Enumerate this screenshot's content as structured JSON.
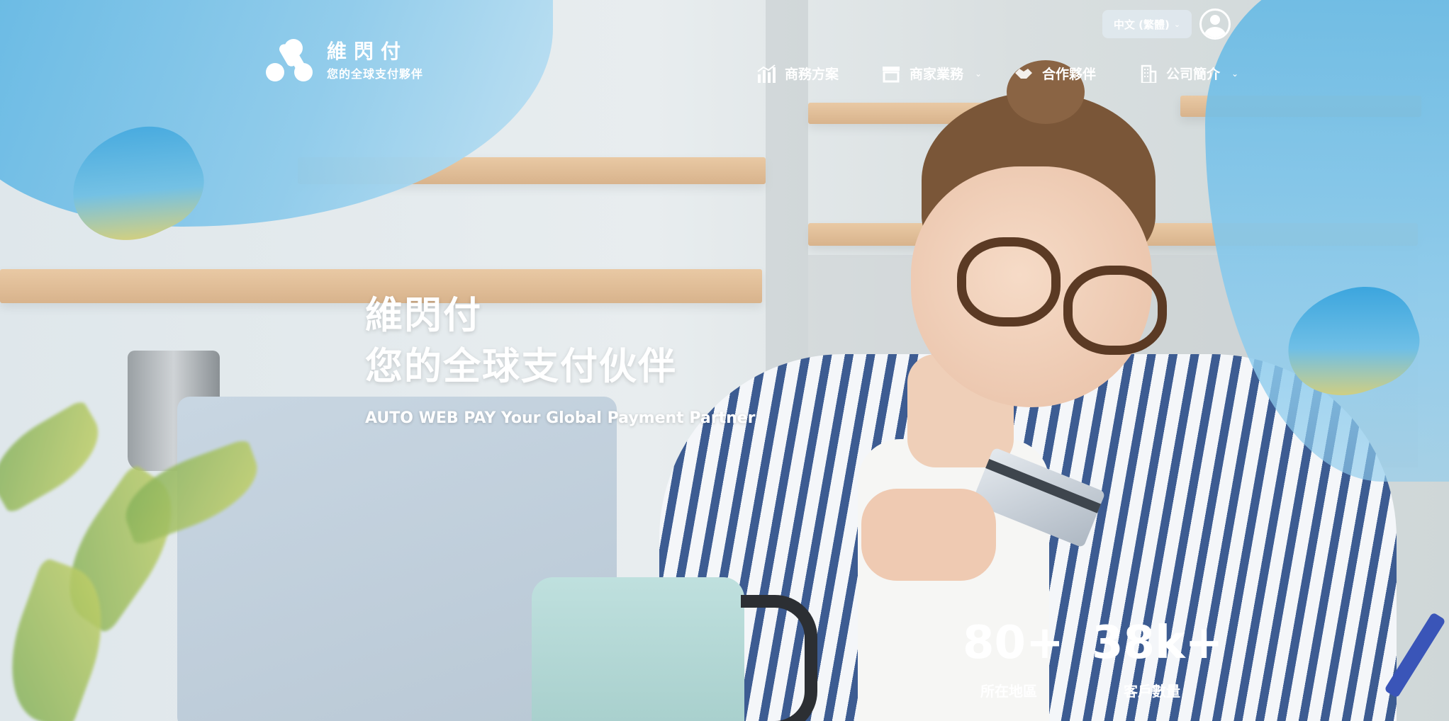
{
  "brand": {
    "name": "維閃付",
    "tagline": "您的全球支付夥伴",
    "accent": "#5fb6e3",
    "highlight": "#f2d45e"
  },
  "header": {
    "language": "中文 (繁體)",
    "language_icon": "chevron-down-icon",
    "account_icon": "user-icon",
    "nav": [
      {
        "label": "商務方案",
        "icon": "bar-chart-icon",
        "has_dropdown": false
      },
      {
        "label": "商家業務",
        "icon": "storefront-icon",
        "has_dropdown": true
      },
      {
        "label": "合作夥伴",
        "icon": "handshake-icon",
        "has_dropdown": false
      },
      {
        "label": "公司簡介",
        "icon": "building-icon",
        "has_dropdown": true
      }
    ]
  },
  "hero": {
    "title_line1": "維閃付",
    "title_line2": "您的全球支付伙伴",
    "subtitle": "AUTO WEB PAY Your Global Payment Partner"
  },
  "stats": [
    {
      "value": "80+",
      "label": "所在地區"
    },
    {
      "value": "38k+",
      "label": "客戶數量"
    }
  ]
}
